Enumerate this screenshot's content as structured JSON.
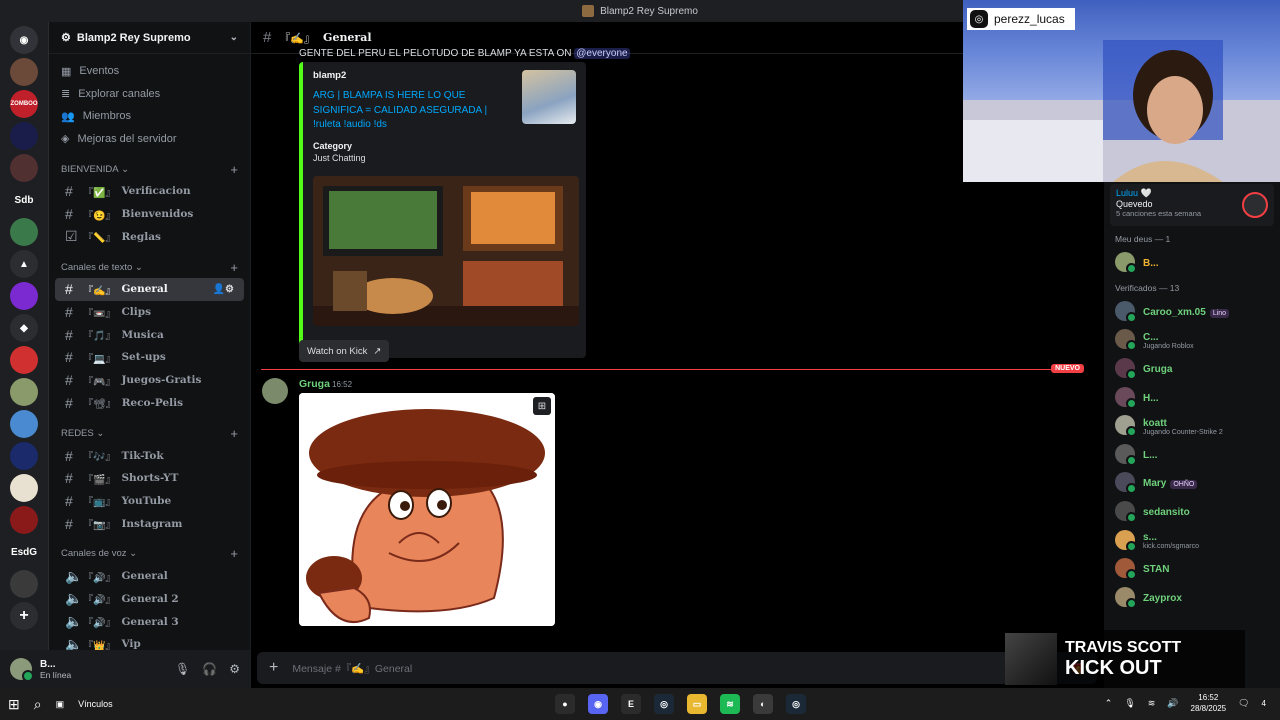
{
  "window": {
    "title": "Blamp2 Rey Supremo"
  },
  "server": {
    "name": "Blamp2 Rey Supremo",
    "menu": [
      "Eventos",
      "Explorar canales",
      "Miembros",
      "Mejoras del servidor"
    ]
  },
  "server_rail": [
    "Sdb",
    "EsdG"
  ],
  "categories": {
    "bienvenida": "BIENVENIDA",
    "texto": "Canales de texto",
    "redes": "REDES",
    "voz": "Canales de voz"
  },
  "channels": {
    "bienvenida": [
      {
        "prefix": "『✅』",
        "name": "Verificacion"
      },
      {
        "prefix": "『😉』",
        "name": "Bienvenidos"
      },
      {
        "prefix": "『📏』",
        "name": "Reglas"
      }
    ],
    "texto": [
      {
        "prefix": "『✍』",
        "name": "General"
      },
      {
        "prefix": "『📼』",
        "name": "Clips"
      },
      {
        "prefix": "『🎵』",
        "name": "Musica"
      },
      {
        "prefix": "『💻』",
        "name": "Set-ups"
      },
      {
        "prefix": "『🎮』",
        "name": "Juegos-Gratis"
      },
      {
        "prefix": "『📽』",
        "name": "Reco-Pelis"
      }
    ],
    "redes": [
      {
        "prefix": "『🎶』",
        "name": "Tik-Tok"
      },
      {
        "prefix": "『🎬』",
        "name": "Shorts-YT"
      },
      {
        "prefix": "『📺』",
        "name": "YouTube"
      },
      {
        "prefix": "『📷』",
        "name": "Instagram"
      }
    ],
    "voz": [
      {
        "prefix": "『🔊』",
        "name": "General"
      },
      {
        "prefix": "『🔊』",
        "name": "General 2"
      },
      {
        "prefix": "『🔊』",
        "name": "General 3"
      },
      {
        "prefix": "『👑』",
        "name": "Vip"
      }
    ]
  },
  "current_channel": {
    "prefix": "『✍』",
    "name": "General"
  },
  "user": {
    "name": "B...",
    "status": "En línea"
  },
  "messages": {
    "top_text": "GENTE DEL PERU EL PELOTUDO DE BLAMP YA ESTA ON",
    "mention": "@everyone",
    "embed": {
      "author": "blamp2",
      "title": "ARG | BLAMPA IS HERE LO QUE SIGNIFICA = CALIDAD ASEGURADA | !ruleta !audio !ds",
      "field_label": "Category",
      "field_value": "Just Chatting",
      "button": "Watch on Kick"
    },
    "new_tag": "NUEVO",
    "second": {
      "author": "Gruga",
      "time": "16:52"
    }
  },
  "composer": {
    "placeholder": "Mensaje #『✍』General"
  },
  "activity": {
    "user": "Luluu 🤍",
    "song": "Quevedo",
    "sub": "5 canciones esta semana"
  },
  "member_groups": [
    {
      "title": "Meu deus — 1",
      "members": [
        {
          "name": "B...",
          "color": "#f0b232",
          "sub": "",
          "badge": ""
        }
      ]
    },
    {
      "title": "Verificados — 13",
      "members": [
        {
          "name": "Caroo_xm.05",
          "color": "#6fd17c",
          "sub": "",
          "badge": "Lino"
        },
        {
          "name": "C...",
          "color": "#6fd17c",
          "sub": "Jugando Roblox",
          "badge": ""
        },
        {
          "name": "Gruga",
          "color": "#6fd17c",
          "sub": "",
          "badge": ""
        },
        {
          "name": "H...",
          "color": "#6fd17c",
          "sub": "",
          "badge": ""
        },
        {
          "name": "koatt",
          "color": "#6fd17c",
          "sub": "Jugando Counter-Strike 2",
          "badge": ""
        },
        {
          "name": "L...",
          "color": "#6fd17c",
          "sub": "",
          "badge": ""
        },
        {
          "name": "Mary",
          "color": "#6fd17c",
          "sub": "",
          "badge": "OHÑO"
        },
        {
          "name": "sedansito",
          "color": "#6fd17c",
          "sub": "",
          "badge": ""
        },
        {
          "name": "s...",
          "color": "#6fd17c",
          "sub": "kick.com/sgmarco",
          "badge": ""
        },
        {
          "name": "STAN",
          "color": "#6fd17c",
          "sub": "",
          "badge": ""
        },
        {
          "name": "Zayprox",
          "color": "#6fd17c",
          "sub": "",
          "badge": ""
        }
      ]
    }
  ],
  "stream_overlay": {
    "instagram": "perezz_lucas",
    "track_artist": "TRAVIS SCOTT",
    "track_title": "KICK OUT"
  },
  "taskbar": {
    "links": "Vínculos",
    "time": "16:52",
    "date": "28/8/2025",
    "notif": "4"
  }
}
